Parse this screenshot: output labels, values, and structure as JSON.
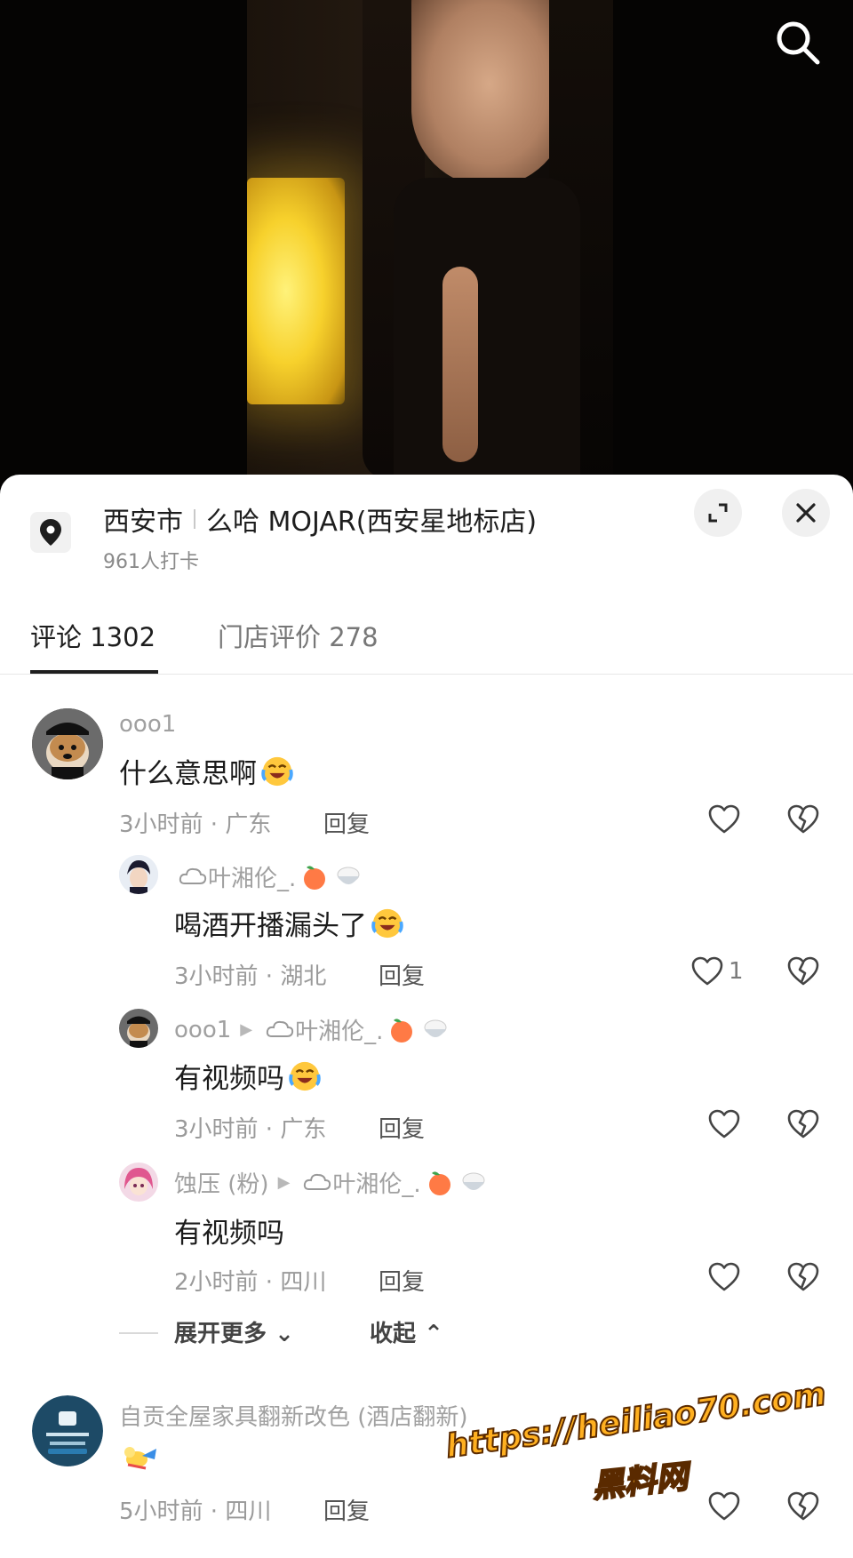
{
  "location": {
    "city": "西安市",
    "venue": "么哈 MOJAR(西安星地标店)",
    "checkins": "961人打卡"
  },
  "tabs": [
    {
      "label": "评论 1302"
    },
    {
      "label": "门店评价 278"
    }
  ],
  "comments": [
    {
      "user": "ooo1",
      "text": "什么意思啊",
      "time": "3小时前 · 广东",
      "reply": "回复"
    },
    {
      "user": "叶湘伦_.",
      "text": "喝酒开播漏头了",
      "time": "3小时前 · 湖北",
      "reply": "回复",
      "likes": "1"
    },
    {
      "user": "ooo1",
      "reply_to": "叶湘伦_.",
      "text": "有视频吗",
      "time": "3小时前 · 广东",
      "reply": "回复"
    },
    {
      "user": "蚀压 (粉)",
      "reply_to": "叶湘伦_.",
      "text": "有视频吗",
      "time": "2小时前 · 四川",
      "reply": "回复"
    },
    {
      "user": "自贡全屋家具翻新改色 (酒店翻新)",
      "text": "",
      "time": "5小时前 · 四川",
      "reply": "回复"
    }
  ],
  "thread": {
    "expand": "展开更多",
    "collapse": "收起"
  },
  "watermark": {
    "url": "https://heiliao70.com",
    "name": "黑料网"
  },
  "icons": [
    "search-icon",
    "location-pin-icon",
    "expand-icon",
    "close-icon",
    "heart-icon",
    "broken-heart-icon",
    "chevron-down-icon",
    "chevron-up-icon"
  ]
}
